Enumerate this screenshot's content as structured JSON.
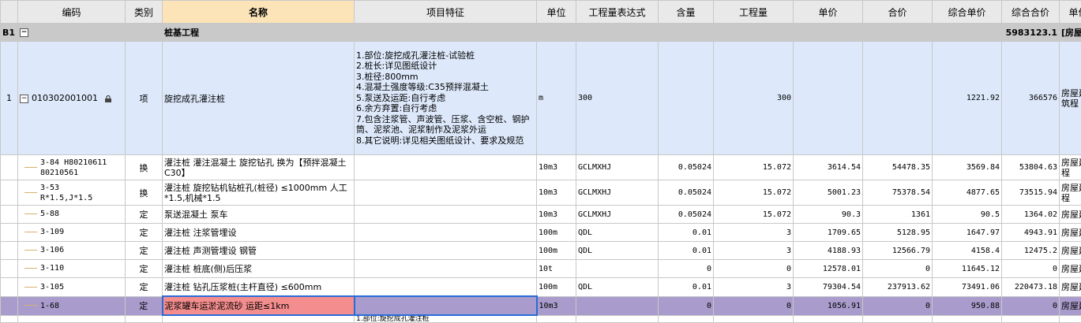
{
  "headers": {
    "code": "编码",
    "type": "类别",
    "name": "名称",
    "feature": "项目特征",
    "unit": "单位",
    "expr": "工程量表达式",
    "content": "含量",
    "qty": "工程量",
    "price": "单价",
    "total": "合价",
    "comp_price": "综合单价",
    "comp_total": "综合合价",
    "extra": "单价"
  },
  "section": {
    "index": "B1",
    "name": "桩基工程",
    "comp_total": "5983123.1",
    "extra": "[房屋建"
  },
  "main": {
    "index": "1",
    "code": "010302001001",
    "type": "项",
    "name": "旋挖成孔灌注桩",
    "feature": "1.部位:旋挖成孔灌注桩-试验桩\n2.桩长:详见图纸设计\n3.桩径:800mm\n4.混凝土强度等级:C35预拌混凝土\n5.泵送及运距:自行考虑\n6.余方弃置:自行考虑\n7.包含注浆管、声波管、压浆、含空桩、钢护筒、泥浆池、泥浆制作及泥浆外运\n8.其它说明:详见相关图纸设计、要求及规范",
    "unit": "m",
    "expr": "300",
    "qty": "300",
    "comp_price": "1221.92",
    "comp_total": "366576",
    "extra": "房屋建筑程"
  },
  "rows": [
    {
      "code": "3-84 H80210611 80210561",
      "type": "换",
      "name": "灌注桩 灌注混凝土 旋挖钻孔  换为【预拌混凝土 C30】",
      "unit": "10m3",
      "expr": "GCLMXHJ",
      "content": "0.05024",
      "qty": "15.072",
      "price": "3614.54",
      "total": "54478.35",
      "comp_price": "3569.84",
      "comp_total": "53804.63",
      "extra": "房屋建程"
    },
    {
      "code": "3-53 R*1.5,J*1.5",
      "type": "换",
      "name": "灌注桩 旋挖钻机钻桩孔(桩径) ≤1000mm 人工*1.5,机械*1.5",
      "unit": "10m3",
      "expr": "GCLMXHJ",
      "content": "0.05024",
      "qty": "15.072",
      "price": "5001.23",
      "total": "75378.54",
      "comp_price": "4877.65",
      "comp_total": "73515.94",
      "extra": "房屋建程"
    },
    {
      "code": "5-88",
      "type": "定",
      "name": "泵送混凝土 泵车",
      "unit": "10m3",
      "expr": "GCLMXHJ",
      "content": "0.05024",
      "qty": "15.072",
      "price": "90.3",
      "total": "1361",
      "comp_price": "90.5",
      "comp_total": "1364.02",
      "extra": "房屋建"
    },
    {
      "code": "3-109",
      "type": "定",
      "name": "灌注桩 注浆管埋设",
      "unit": "100m",
      "expr": "QDL",
      "content": "0.01",
      "qty": "3",
      "price": "1709.65",
      "total": "5128.95",
      "comp_price": "1647.97",
      "comp_total": "4943.91",
      "extra": "房屋建"
    },
    {
      "code": "3-106",
      "type": "定",
      "name": "灌注桩 声测管埋设 钢管",
      "unit": "100m",
      "expr": "QDL",
      "content": "0.01",
      "qty": "3",
      "price": "4188.93",
      "total": "12566.79",
      "comp_price": "4158.4",
      "comp_total": "12475.2",
      "extra": "房屋建"
    },
    {
      "code": "3-110",
      "type": "定",
      "name": "灌注桩 桩底(侧)后压浆",
      "unit": "10t",
      "expr": "",
      "content": "0",
      "qty": "0",
      "price": "12578.01",
      "total": "0",
      "comp_price": "11645.12",
      "comp_total": "0",
      "extra": "房屋建"
    },
    {
      "code": "3-105",
      "type": "定",
      "name": "灌注桩 钻孔压浆桩(主杆直径) ≤600mm",
      "unit": "100m",
      "expr": "QDL",
      "content": "0.01",
      "qty": "3",
      "price": "79304.54",
      "total": "237913.62",
      "comp_price": "73491.06",
      "comp_total": "220473.18",
      "extra": "房屋建"
    }
  ],
  "selected": {
    "code": "1-68",
    "type": "定",
    "name": "泥浆罐车运淤泥流砂 运距≤1km",
    "unit": "10m3",
    "expr": "",
    "content": "0",
    "qty": "0",
    "price": "1056.91",
    "total": "0",
    "comp_price": "950.88",
    "comp_total": "0",
    "extra": "房屋建"
  },
  "next_feature": "1.部位:旋挖成孔灌注桩"
}
